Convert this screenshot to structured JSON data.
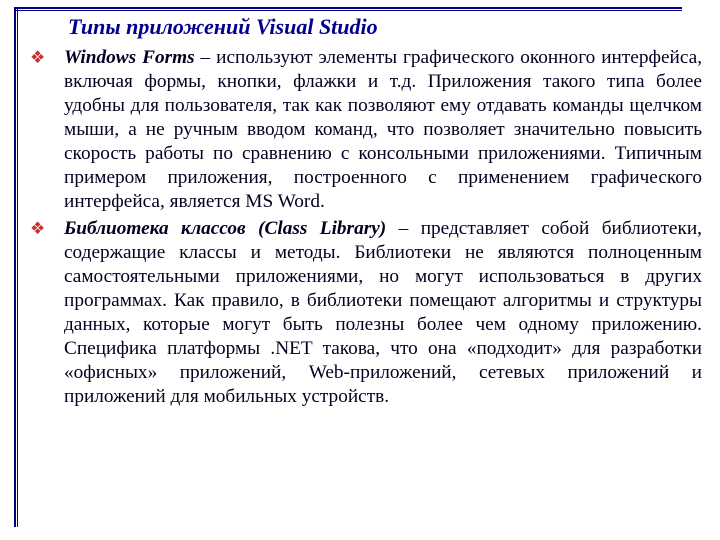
{
  "title": "Типы приложений Visual Studio",
  "items": [
    {
      "lead": "Windows Forms",
      "sep": " – ",
      "body": "используют элементы графического оконного интерфейса, включая формы, кнопки, флажки и т.д. Приложения такого типа более удобны для пользователя, так как позволяют ему отдавать команды щелчком мыши, а не ручным вводом команд, что позволяет значительно повысить скорость работы по сравнению с консольными приложениями. Типичным примером приложения, построенного с применением графического интерфейса, является MS Word."
    },
    {
      "lead": "Библиотека классов (Class Library)",
      "sep": " – ",
      "body": "представляет собой библиотеки, содержащие классы и методы. Библиотеки не являются полноценным самостоятельными приложениями, но могут использоваться в других программах. Как правило, в библиотеки помещают алгоритмы и структуры данных, которые могут быть полезны более чем одному приложению. Специфика платформы .NET такова, что она «подходит» для разработки «офисных» приложений, Web-приложений, сетевых приложений и приложений для мобильных устройств."
    }
  ]
}
